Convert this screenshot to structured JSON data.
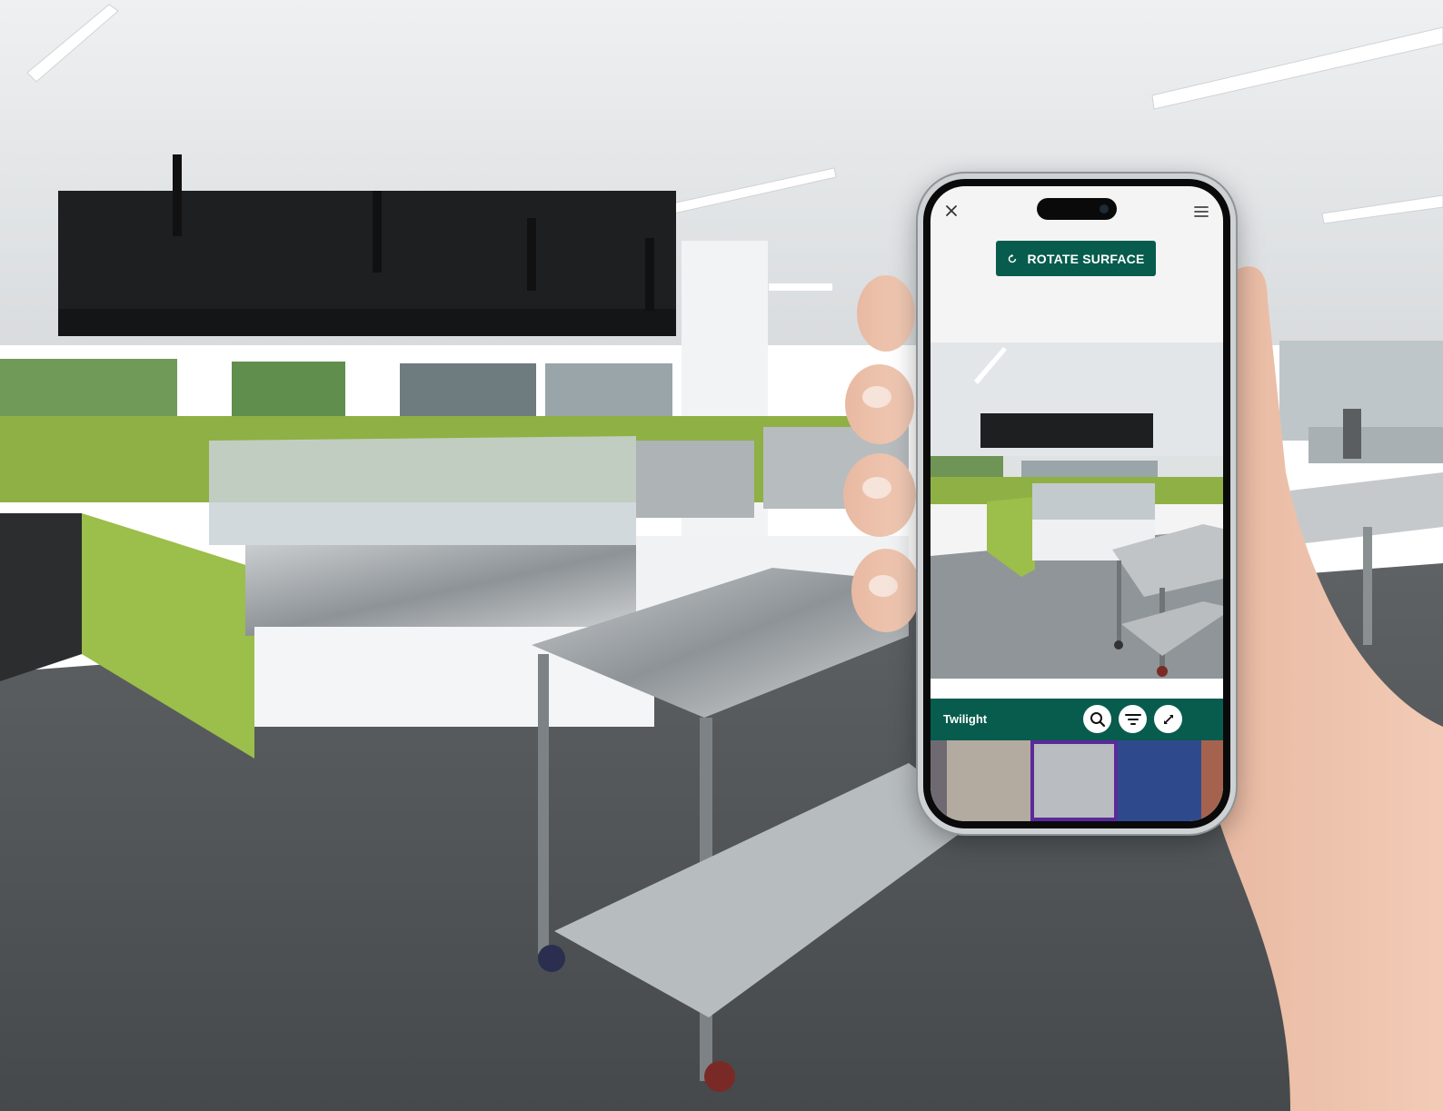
{
  "app": {
    "rotate_button_label": "ROTATE SURFACE",
    "selected_surface_name": "Twilight",
    "accent_color": "#075c4d",
    "selection_color": "#5a2a9a"
  },
  "icons": {
    "close": "close-icon",
    "menu": "hamburger-menu-icon",
    "rotate": "rotate-icon",
    "search": "search-icon",
    "filter": "filter-icon",
    "expand": "expand-icon"
  },
  "swatches": [
    {
      "id": "sand",
      "color": "#b3aaa0",
      "selected": false
    },
    {
      "id": "twilight",
      "color": "#b9bcc0",
      "selected": true
    },
    {
      "id": "navy",
      "color": "#2f4a8c",
      "selected": false
    },
    {
      "id": "terracotta",
      "color": "#a5634f",
      "selected": false
    }
  ]
}
